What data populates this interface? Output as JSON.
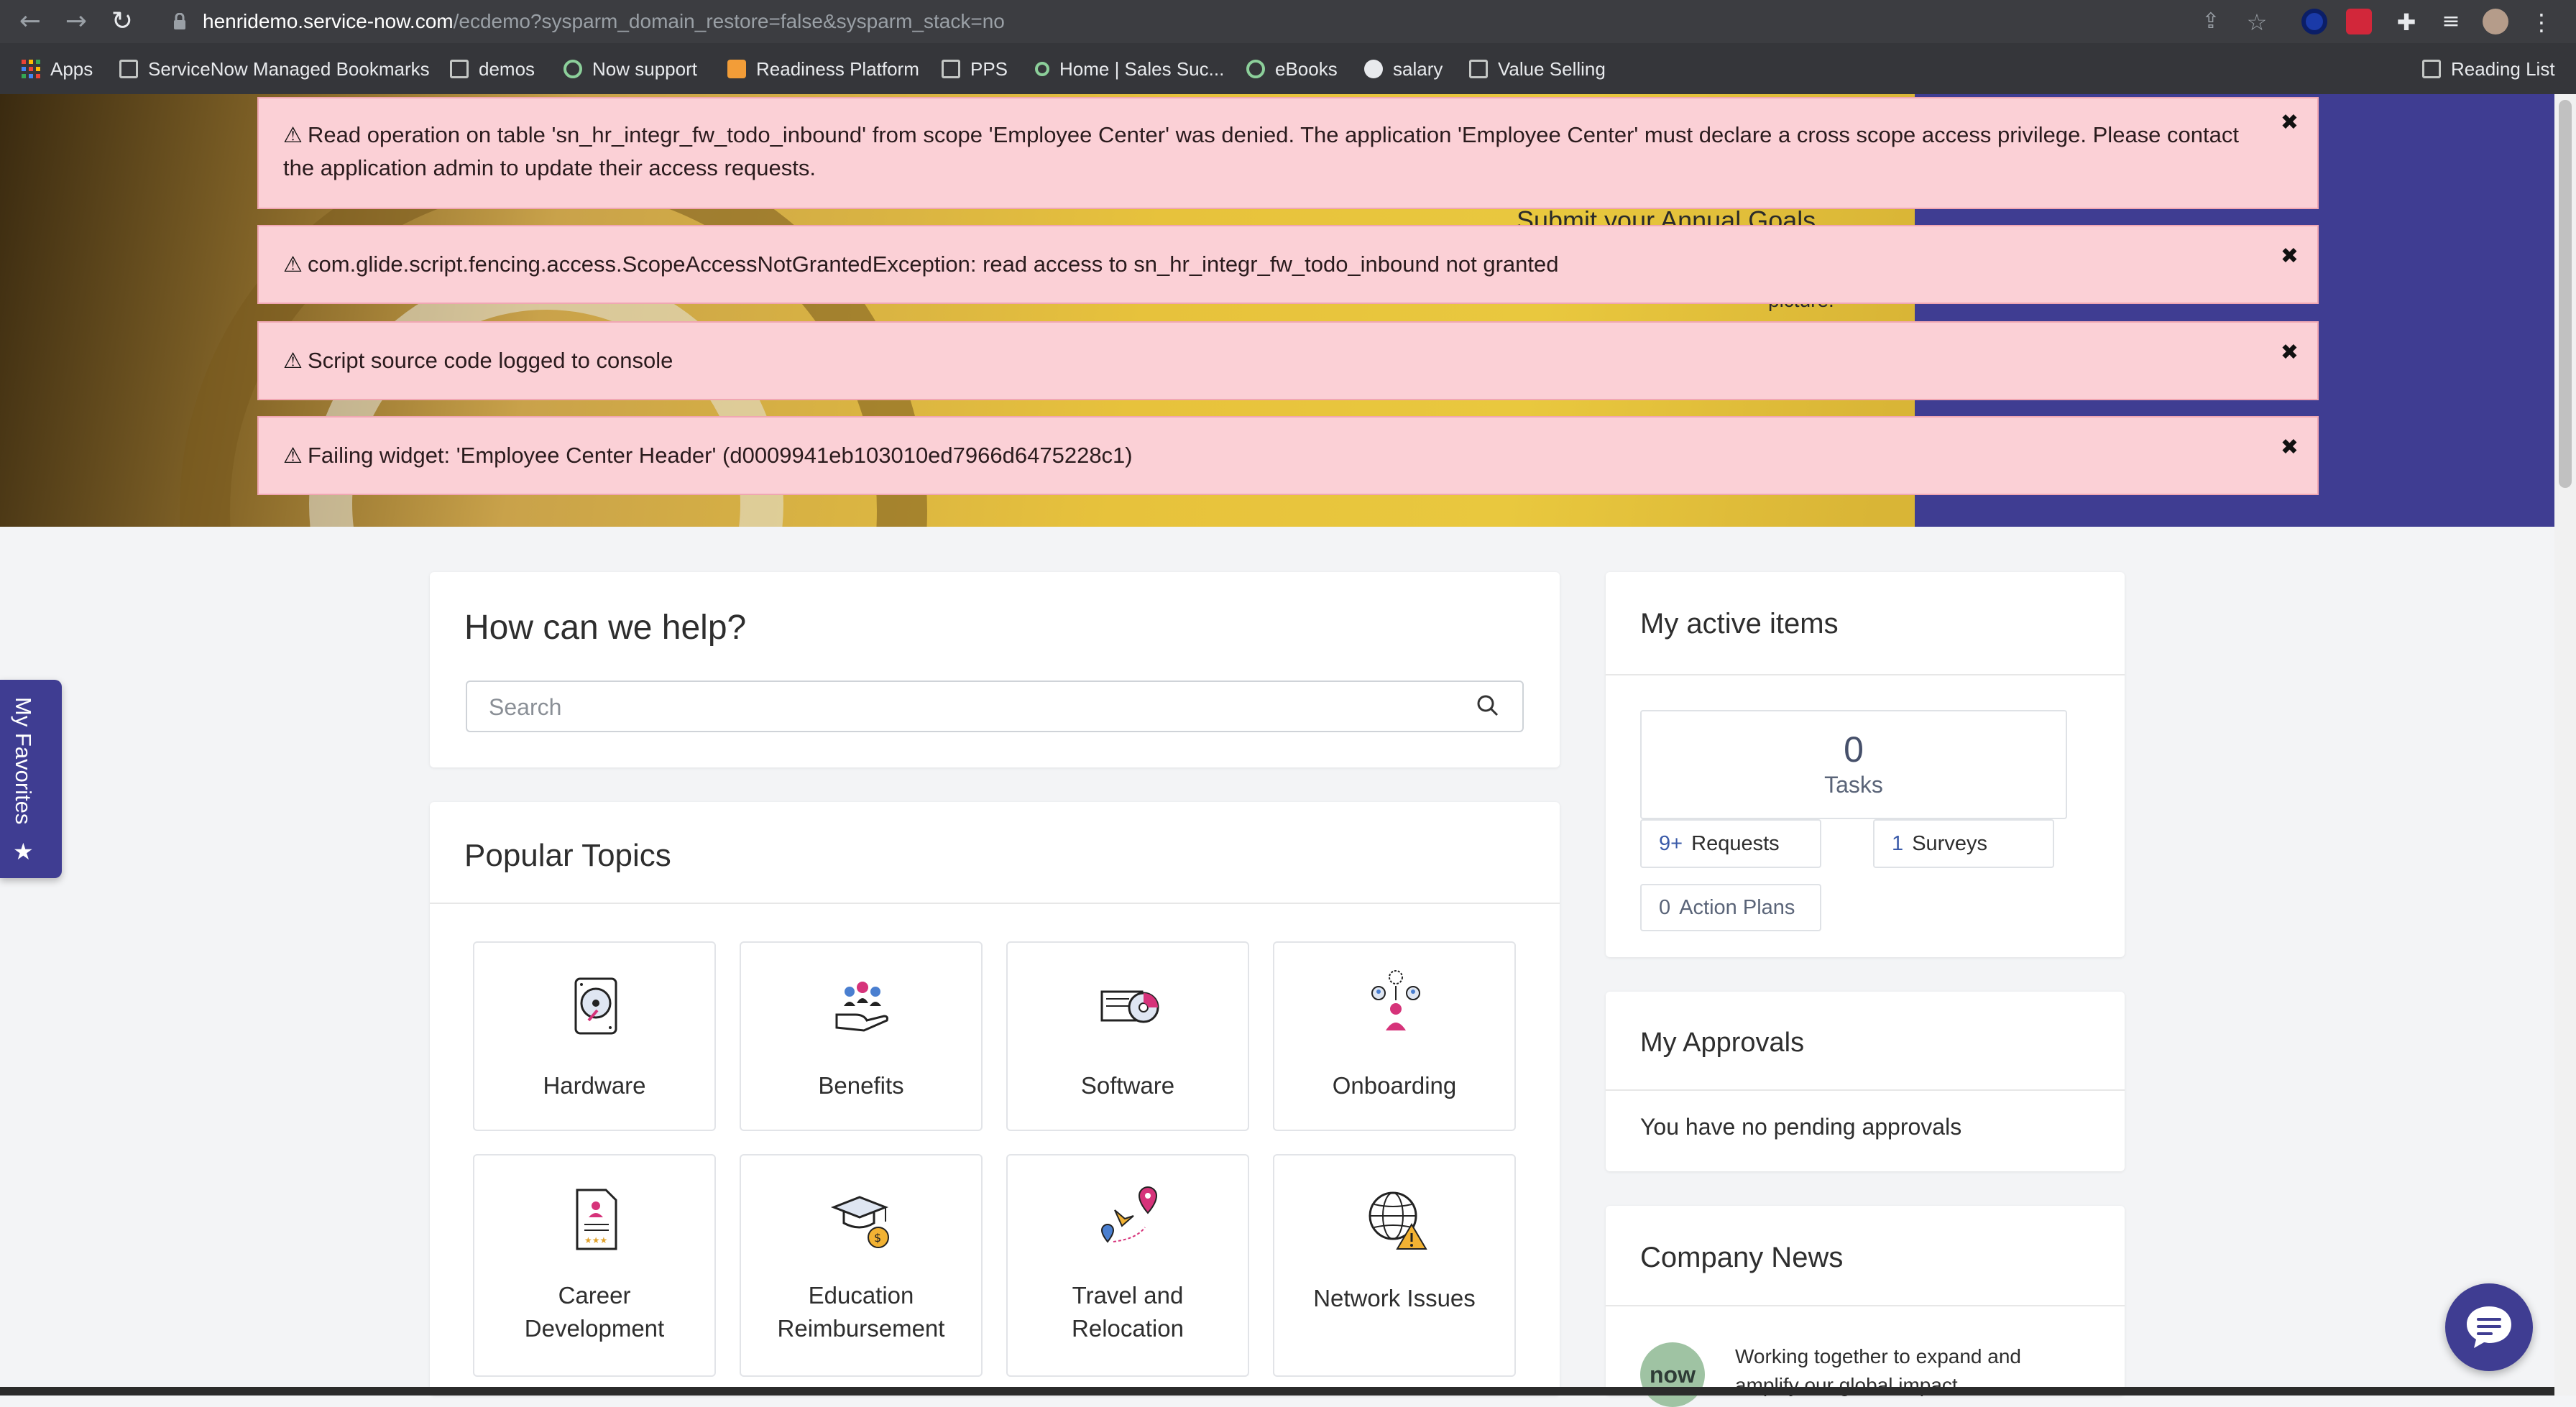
{
  "browser": {
    "url_host": "henridemo.service-now.com",
    "url_path": "/ecdemo?sysparm_domain_restore=false&sysparm_stack=no",
    "bookmarks": [
      "Apps",
      "ServiceNow Managed Bookmarks",
      "demos",
      "Now support",
      "Readiness Platform",
      "PPS",
      "Home | Sales Suc...",
      "eBooks",
      "salary",
      "Value Selling"
    ],
    "reading_list": "Reading List"
  },
  "hero": {
    "partial_text": "Submit your Annual Goals",
    "partial_text2": "picture."
  },
  "alerts": [
    "Read operation on table 'sn_hr_integr_fw_todo_inbound' from scope 'Employee Center' was denied. The application 'Employee Center' must declare a cross scope access privilege. Please contact the application admin to update their access requests.",
    "com.glide.script.fencing.access.ScopeAccessNotGrantedException: read access to sn_hr_integr_fw_todo_inbound not granted",
    "Script source code logged to console",
    "Failing widget: 'Employee Center Header' (d0009941eb103010ed7966d6475228c1)"
  ],
  "favorites": {
    "label": "My Favorites"
  },
  "help": {
    "title": "How can we help?",
    "search_placeholder": "Search"
  },
  "popular": {
    "title": "Popular Topics",
    "topics": [
      "Hardware",
      "Benefits",
      "Software",
      "Onboarding",
      "Career\nDevelopment",
      "Education\nReimbursement",
      "Travel and\nRelocation",
      "Network Issues"
    ]
  },
  "active_items": {
    "title": "My active items",
    "tasks_count": "0",
    "tasks_label": "Tasks",
    "requests_count": "9+",
    "requests_label": "Requests",
    "surveys_count": "1",
    "surveys_label": "Surveys",
    "action_plans_count": "0",
    "action_plans_label": "Action Plans"
  },
  "approvals": {
    "title": "My Approvals",
    "empty_text": "You have no pending approvals"
  },
  "news": {
    "title": "Company News",
    "logo_text": "now",
    "item_text": "Working together to expand and amplify our global impact"
  },
  "colors": {
    "brand": "#3f3d92",
    "alert_bg": "#fbd0d6",
    "link_blue": "#3b5ba9"
  }
}
